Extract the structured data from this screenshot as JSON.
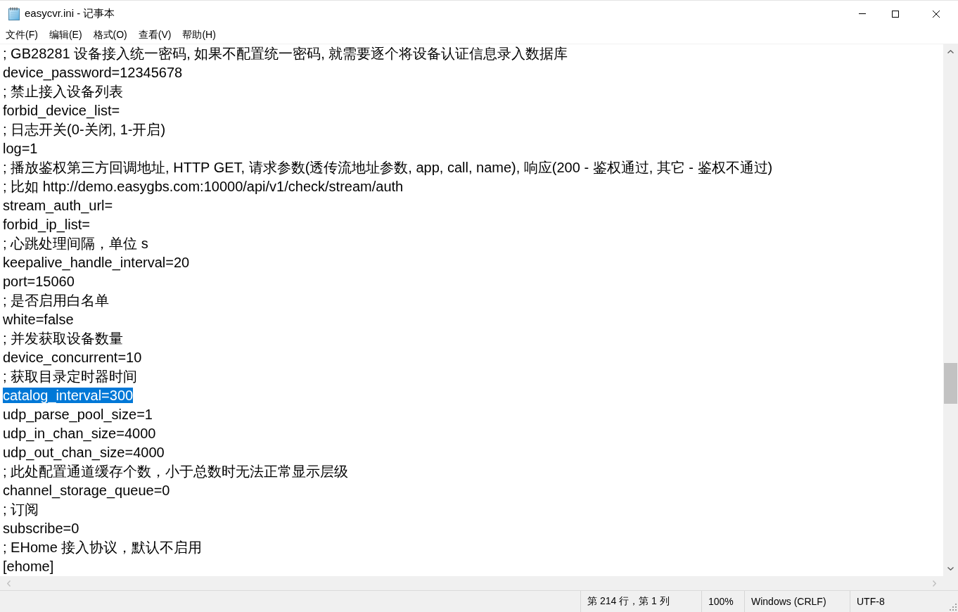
{
  "window": {
    "title": "easycvr.ini - 记事本"
  },
  "menu": [
    "文件(F)",
    "编辑(E)",
    "格式(O)",
    "查看(V)",
    "帮助(H)"
  ],
  "editor": {
    "lines": [
      {
        "text": "; GB28281 设备接入统一密码, 如果不配置统一密码, 就需要逐个将设备认证信息录入数据库",
        "selected": false
      },
      {
        "text": "device_password=12345678",
        "selected": false
      },
      {
        "text": "; 禁止接入设备列表",
        "selected": false
      },
      {
        "text": "forbid_device_list=",
        "selected": false
      },
      {
        "text": "; 日志开关(0-关闭, 1-开启)",
        "selected": false
      },
      {
        "text": "log=1",
        "selected": false
      },
      {
        "text": "; 播放鉴权第三方回调地址, HTTP GET, 请求参数(透传流地址参数, app, call, name), 响应(200 - 鉴权通过, 其它 - 鉴权不通过)",
        "selected": false
      },
      {
        "text": "; 比如 http://demo.easygbs.com:10000/api/v1/check/stream/auth",
        "selected": false
      },
      {
        "text": "stream_auth_url=",
        "selected": false
      },
      {
        "text": "forbid_ip_list=",
        "selected": false
      },
      {
        "text": "; 心跳处理间隔，单位 s",
        "selected": false
      },
      {
        "text": "keepalive_handle_interval=20",
        "selected": false
      },
      {
        "text": "port=15060",
        "selected": false
      },
      {
        "text": "; 是否启用白名单",
        "selected": false
      },
      {
        "text": "white=false",
        "selected": false
      },
      {
        "text": "; 并发获取设备数量",
        "selected": false
      },
      {
        "text": "device_concurrent=10",
        "selected": false
      },
      {
        "text": "; 获取目录定时器时间",
        "selected": false
      },
      {
        "text": "catalog_interval=300",
        "selected": true
      },
      {
        "text": "udp_parse_pool_size=1",
        "selected": false
      },
      {
        "text": "udp_in_chan_size=4000",
        "selected": false
      },
      {
        "text": "udp_out_chan_size=4000",
        "selected": false
      },
      {
        "text": "; 此处配置通道缓存个数，小于总数时无法正常显示层级",
        "selected": false
      },
      {
        "text": "channel_storage_queue=0",
        "selected": false
      },
      {
        "text": "; 订阅",
        "selected": false
      },
      {
        "text": "subscribe=0",
        "selected": false
      },
      {
        "text": "; EHome 接入协议，默认不启用",
        "selected": false
      },
      {
        "text": "[ehome]",
        "selected": false
      }
    ]
  },
  "status_bar": {
    "position": "第 214 行，第 1 列",
    "zoom": "100%",
    "line_ending": "Windows (CRLF)",
    "encoding": "UTF-8"
  }
}
